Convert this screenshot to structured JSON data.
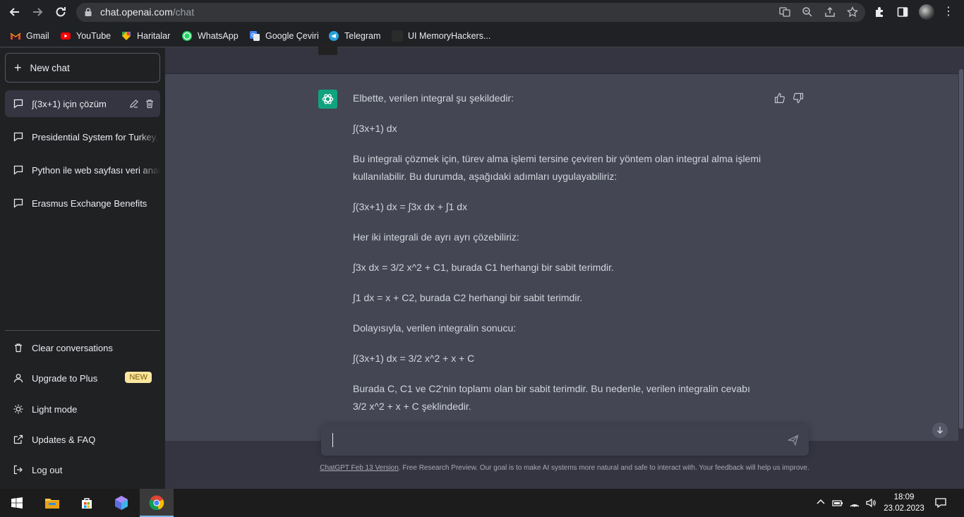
{
  "browser": {
    "url_host": "chat.openai.com",
    "url_path": "/chat",
    "icons": [
      "back-icon",
      "forward-icon",
      "reload-icon",
      "lock-icon",
      "translate-icon",
      "zoom-icon",
      "share-icon",
      "star-icon",
      "extensions-icon",
      "sidepanel-icon",
      "profile-avatar",
      "menu-icon"
    ]
  },
  "bookmarks": [
    {
      "label": "Gmail",
      "icon": "gmail-icon",
      "color": "#ea4335"
    },
    {
      "label": "YouTube",
      "icon": "youtube-icon",
      "color": "#ff0000"
    },
    {
      "label": "Haritalar",
      "icon": "maps-icon",
      "color": "#34a853"
    },
    {
      "label": "WhatsApp",
      "icon": "whatsapp-icon",
      "color": "#25d366"
    },
    {
      "label": "Google Çeviri",
      "icon": "translate-icon",
      "color": "#4285f4"
    },
    {
      "label": "Telegram",
      "icon": "telegram-icon",
      "color": "#2aa1da"
    },
    {
      "label": "UI MemoryHackers...",
      "icon": "site-icon",
      "color": "#333333"
    }
  ],
  "sidebar": {
    "new_chat": "New chat",
    "conversations": [
      {
        "label": "∫(3x+1) için çözüm",
        "active": true
      },
      {
        "label": "Presidential System for Turkey.",
        "active": false
      },
      {
        "label": "Python ile web sayfası veri anal",
        "active": false
      },
      {
        "label": "Erasmus Exchange Benefits",
        "active": false
      }
    ],
    "bottom": {
      "clear": "Clear conversations",
      "upgrade": "Upgrade to Plus",
      "upgrade_badge": "NEW",
      "light_mode": "Light mode",
      "updates": "Updates & FAQ",
      "logout": "Log out"
    }
  },
  "chat": {
    "assistant_message": [
      "Elbette, verilen integral şu şekildedir:",
      "∫(3x+1) dx",
      "Bu integrali çözmek için, türev alma işlemi tersine çeviren bir yöntem olan integral alma işlemi kullanılabilir. Bu durumda, aşağıdaki adımları uygulayabiliriz:",
      "∫(3x+1) dx = ∫3x dx + ∫1 dx",
      "Her iki integrali de ayrı ayrı çözebiliriz:",
      "∫3x dx = 3/2 x^2 + C1, burada C1 herhangi bir sabit terimdir.",
      "∫1 dx = x + C2, burada C2 herhangi bir sabit terimdir.",
      "Dolayısıyla, verilen integralin sonucu:",
      "∫(3x+1) dx = 3/2 x^2 + x + C",
      "Burada C, C1 ve C2'nin toplamı olan bir sabit terimdir. Bu nedenle, verilen integralin cevabı 3/2 x^2 + x + C şeklindedir."
    ],
    "input_placeholder": "",
    "footer_link": "ChatGPT Feb 13 Version",
    "footer_text": ". Free Research Preview. Our goal is to make AI systems more natural and safe to interact with. Your feedback will help us improve."
  },
  "taskbar": {
    "time": "18:09",
    "date": "23.02.2023",
    "apps": [
      "windows-start-icon",
      "file-explorer-icon",
      "store-icon",
      "app-icon",
      "chrome-icon"
    ]
  },
  "colors": {
    "sidebar_bg": "#202123",
    "main_bg": "#343541",
    "assistant_bg": "#444654",
    "gpt_green": "#10a37f"
  }
}
